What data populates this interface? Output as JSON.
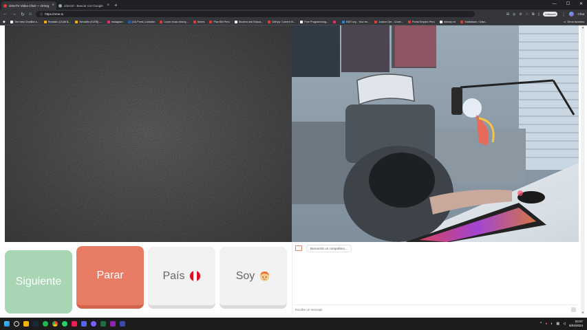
{
  "browser": {
    "tabs": [
      {
        "title": "OmeTV Video Chat — Omeg",
        "active": true,
        "color": "#e53935"
      },
      {
        "title": "omecel - Buscar con Google",
        "active": false,
        "color": "#9aa0a6"
      }
    ],
    "url": "https://ome.tv",
    "profile_label": "Inhosuel",
    "chat_label": "Chat"
  },
  "bookmarks": [
    {
      "label": "The best ChatBot a...",
      "color": "#ffffff"
    },
    {
      "label": "Reclaltin (15,89 $...",
      "color": "#f4b400"
    },
    {
      "label": "Reclaltin (9,87$) -...",
      "color": "#f4b400"
    },
    {
      "label": "Instagram",
      "color": "#e1306c"
    },
    {
      "label": "(10) Feed | LinkedIn",
      "color": "#0a66c2"
    },
    {
      "label": "Learn music theory...",
      "color": "#e53935"
    },
    {
      "label": "Series",
      "color": "#e53935"
    },
    {
      "label": "Plan BM Perú",
      "color": "#e53935"
    },
    {
      "label": "Student and Educa...",
      "color": "#ffffff"
    },
    {
      "label": "GitHyp: Current Vi...",
      "color": "#e53935"
    },
    {
      "label": "Free Programming...",
      "color": "#ffffff"
    },
    {
      "label": "",
      "color": "#e1306c"
    },
    {
      "label": "EDIT.org - Your fre...",
      "color": "#1e88e5"
    },
    {
      "label": "Justice Der - Cover...",
      "color": "#e53935"
    },
    {
      "label": "Portal Empleo Perú",
      "color": "#e53935"
    },
    {
      "label": "melody mi",
      "color": "#ffffff"
    },
    {
      "label": "Statistician / Data...",
      "color": "#e53935"
    }
  ],
  "other_bookmarks": "Otros favoritos",
  "controls": {
    "next_label": "Siguiente",
    "stop_label": "Parar",
    "country_label": "País",
    "gender_label": "Soy"
  },
  "chat": {
    "status": "Buscando un compañero...",
    "input_placeholder": "Escribe un mensaje"
  },
  "taskbar": {
    "time": "03:07",
    "date": "8/04/2024"
  },
  "colors": {
    "next": "#a8d6b4",
    "stop": "#e87c64",
    "neutral": "#f2f2f2"
  }
}
